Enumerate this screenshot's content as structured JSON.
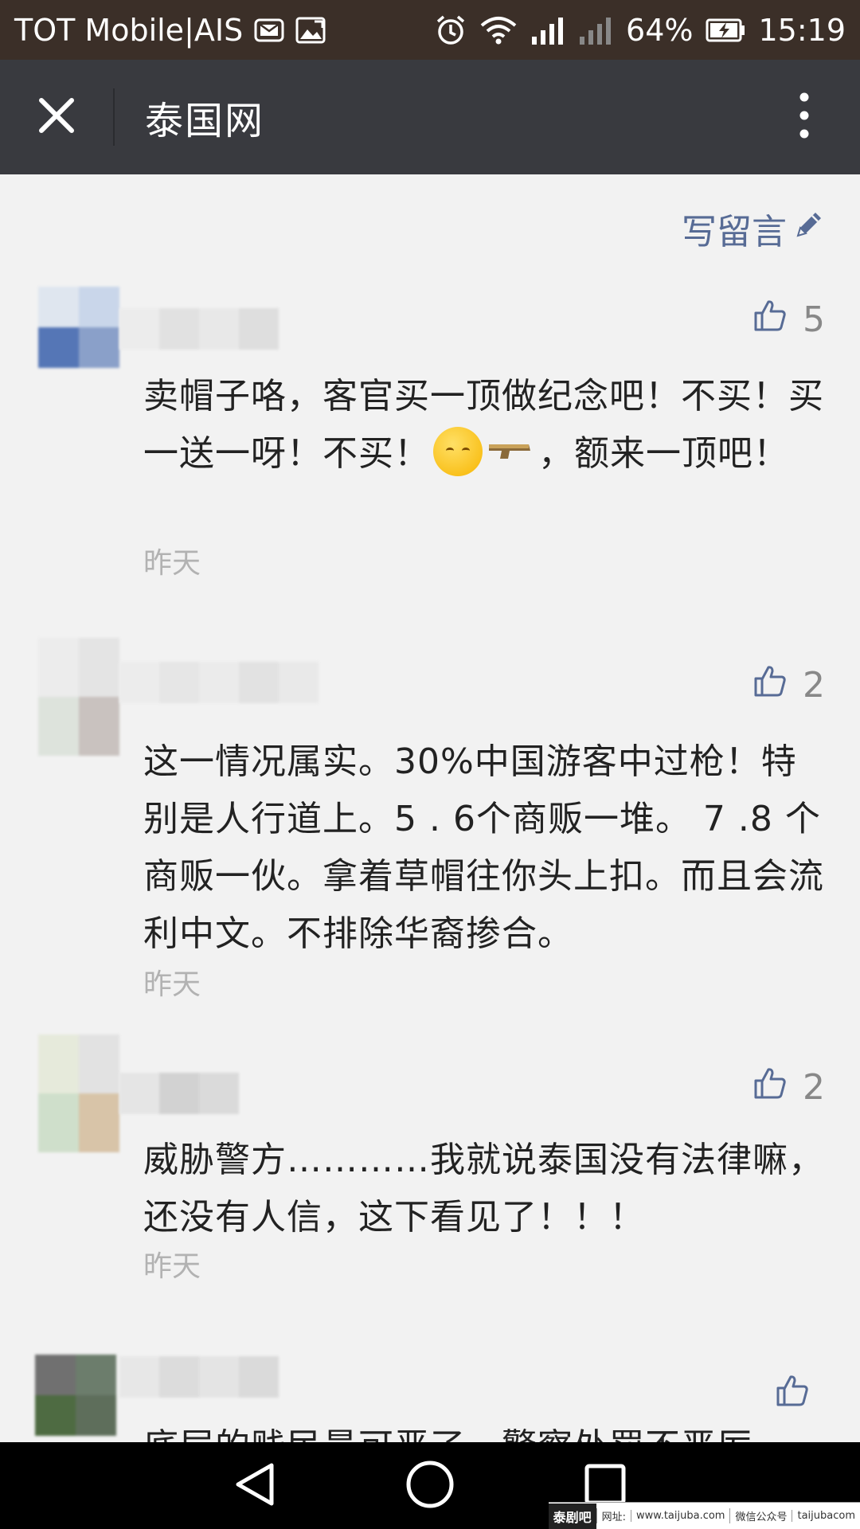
{
  "status_bar": {
    "carrier": "TOT Mobile|AIS",
    "battery": "64%",
    "time": "15:19"
  },
  "header": {
    "title": "泰国网"
  },
  "content": {
    "write_comment_label": "写留言",
    "comments": [
      {
        "likes": "5",
        "text_before": "卖帽子咯，客官买一顶做纪念吧！不买！买一送一呀！不买！",
        "text_after": "，额来一顶吧！",
        "time": "昨天"
      },
      {
        "likes": "2",
        "text": "这一情况属实。30%中国游客中过枪！特别是人行道上。5 . 6个商贩一堆。 7 .8 个商贩一伙。拿着草帽往你头上扣。而且会流利中文。不排除华裔掺合。",
        "time": "昨天"
      },
      {
        "likes": "2",
        "text": "威胁警方…………我就说泰国没有法律嘛，还没有人信，这下看见了！！！",
        "time": "昨天"
      },
      {
        "likes": "",
        "text": "底层的贱民最可恶了，警察处罚不严厉"
      }
    ]
  },
  "watermark": {
    "logo": "泰剧吧",
    "site_label": "网址:",
    "site_url": "www.taijuba.com",
    "wechat_label": "微信公众号",
    "wechat_id": "taijubacom"
  },
  "icons": {
    "close": "close-icon",
    "more": "more-vertical-icon",
    "edit": "pencil-icon",
    "like": "thumbs-up-icon",
    "back": "back-triangle-icon",
    "home": "home-circle-icon",
    "recents": "recents-square-icon"
  },
  "colors": {
    "status_bar_bg": "#3b2f28",
    "header_bg": "#393a3f",
    "page_bg": "#f2f2f2",
    "link_blue": "#576b95",
    "time_gray": "#b2b2b2"
  }
}
